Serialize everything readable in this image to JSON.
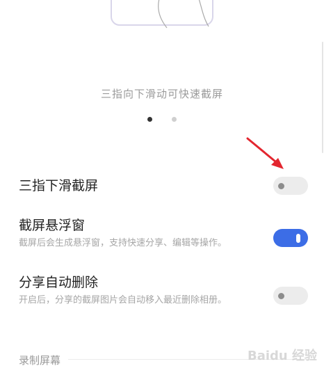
{
  "tutorial": {
    "caption": "三指向下滑动可快速截屏",
    "page_dots": {
      "count": 2,
      "active_index": 0
    }
  },
  "settings": [
    {
      "title": "三指下滑截屏",
      "description": "",
      "enabled": false
    },
    {
      "title": "截屏悬浮窗",
      "description": "截屏后会生成悬浮窗，支持快速分享、编辑等操作。",
      "enabled": true
    },
    {
      "title": "分享自动删除",
      "description": "开启后，分享的截屏图片会自动移入最近删除相册。",
      "enabled": false
    }
  ],
  "section": {
    "title": "录制屏幕"
  },
  "colors": {
    "accent": "#3c6de6",
    "arrow": "#e3262f",
    "toggle_off": "#ececec"
  },
  "watermark": "Baidu 经验"
}
